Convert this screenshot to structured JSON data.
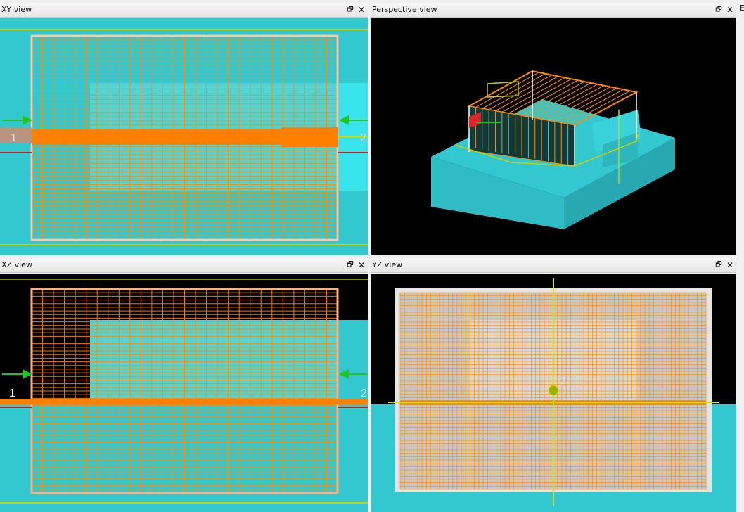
{
  "panes": {
    "xy": {
      "title": "XY view",
      "port_left": "1",
      "port_right": "2"
    },
    "perspective": {
      "title": "Perspective view"
    },
    "xz": {
      "title": "XZ view",
      "port_left": "1",
      "port_right": "2"
    },
    "yz": {
      "title": "YZ view",
      "port_label": "2"
    }
  },
  "controls": {
    "restore_glyph": "🗗",
    "close_glyph": "✕"
  },
  "edge_text": "E",
  "colors": {
    "substrate": "#33c8d0",
    "background_dark": "#000000",
    "mesh": "#ff8c00",
    "trace": "#ff8000",
    "guide_yellow": "#c8d400",
    "port_arrow": "#22c322",
    "boundary_white": "#ffffff"
  },
  "icons": [
    "restore-window-icon",
    "close-icon",
    "port-arrow-icon"
  ]
}
